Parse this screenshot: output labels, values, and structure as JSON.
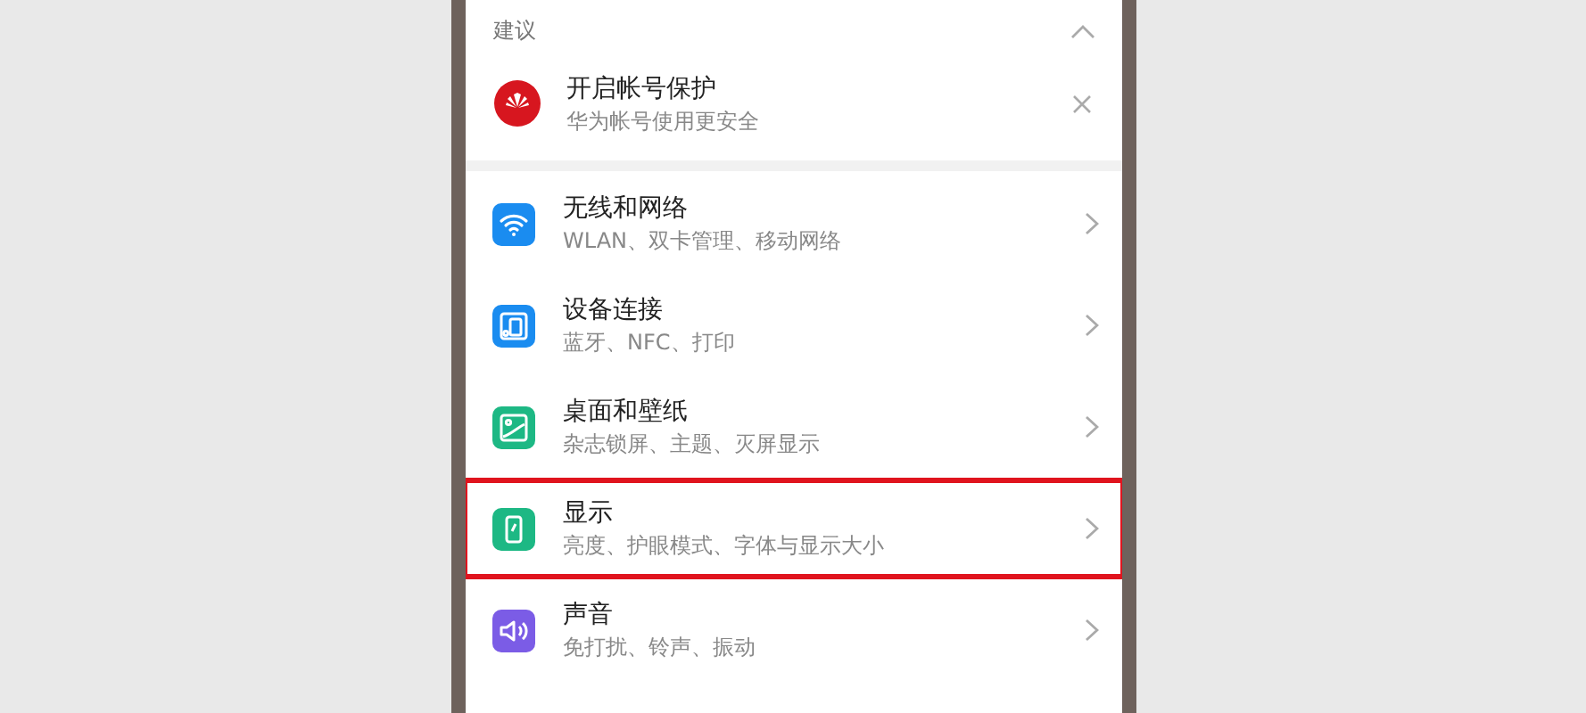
{
  "suggestion": {
    "header": "建议",
    "expanded": true,
    "item": {
      "title": "开启帐号保护",
      "subtitle": "华为帐号使用更安全"
    }
  },
  "settings": [
    {
      "kind": "wifi",
      "color": "#1a8cf0",
      "title": "无线和网络",
      "subtitle": "WLAN、双卡管理、移动网络",
      "highlighted": false
    },
    {
      "kind": "devices",
      "color": "#1a8cf0",
      "title": "设备连接",
      "subtitle": "蓝牙、NFC、打印",
      "highlighted": false
    },
    {
      "kind": "wallpaper",
      "color": "#1db884",
      "title": "桌面和壁纸",
      "subtitle": "杂志锁屏、主题、灭屏显示",
      "highlighted": false
    },
    {
      "kind": "display",
      "color": "#1db884",
      "title": "显示",
      "subtitle": "亮度、护眼模式、字体与显示大小",
      "highlighted": true
    },
    {
      "kind": "sound",
      "color": "#7b5ce6",
      "title": "声音",
      "subtitle": "免打扰、铃声、振动",
      "highlighted": false
    }
  ]
}
